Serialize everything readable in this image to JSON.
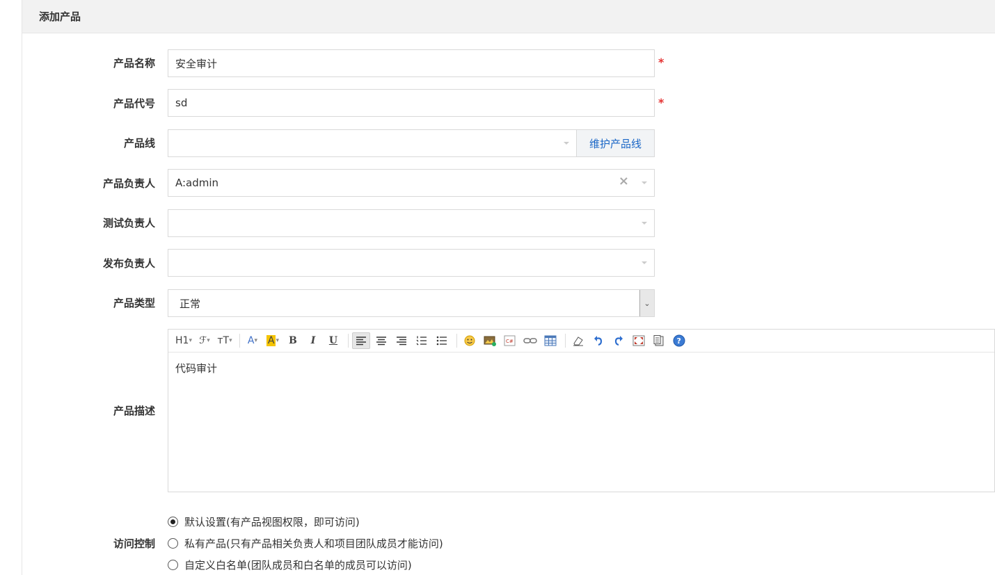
{
  "header": {
    "title": "添加产品"
  },
  "form": {
    "name": {
      "label": "产品名称",
      "value": "安全审计",
      "required_mark": "*"
    },
    "code": {
      "label": "产品代号",
      "value": "sd",
      "required_mark": "*"
    },
    "line": {
      "label": "产品线",
      "value": "",
      "button": "维护产品线"
    },
    "owner": {
      "label": "产品负责人",
      "value": "A:admin",
      "clear": "×"
    },
    "qa": {
      "label": "测试负责人",
      "value": ""
    },
    "release": {
      "label": "发布负责人",
      "value": ""
    },
    "type": {
      "label": "产品类型",
      "value": "正常",
      "arrow": "⌄"
    },
    "desc": {
      "label": "产品描述",
      "content": "代码审计",
      "toolbar": {
        "heading": "H1",
        "font": "ℱ",
        "size": "тT",
        "font_color": "A",
        "bg_color": "A",
        "bold": "B",
        "italic": "I",
        "underline": "U",
        "emoticon": "☺",
        "code": "C#",
        "help": "?"
      }
    },
    "acl": {
      "label": "访问控制",
      "options": [
        {
          "text": "默认设置(有产品视图权限，即可访问)",
          "checked": true
        },
        {
          "text": "私有产品(只有产品相关负责人和项目团队成员才能访问)",
          "checked": false
        },
        {
          "text": "自定义白名单(团队成员和白名单的成员可以访问)",
          "checked": false
        }
      ]
    }
  },
  "colors": {
    "required": "#e53333",
    "link": "#1a66c6",
    "header_bg": "#f2f2f2"
  }
}
